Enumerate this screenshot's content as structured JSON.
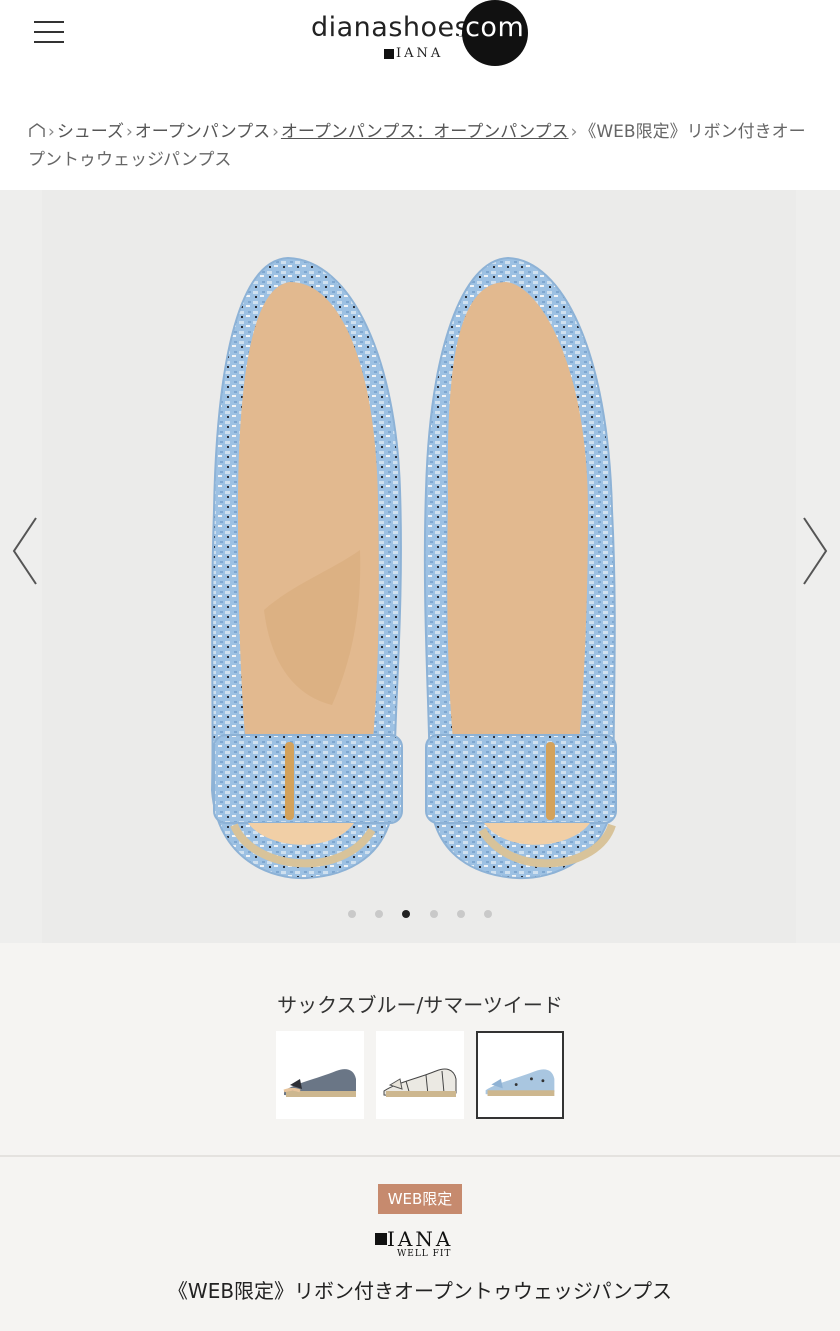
{
  "header": {
    "logo_text": "dianashoes",
    "logo_com": ".com",
    "logo_sub": "IANA",
    "menu_icon": "hamburger-menu-icon"
  },
  "breadcrumb": {
    "home_icon": "home-icon",
    "separator": "›",
    "items": [
      {
        "label": "シューズ"
      },
      {
        "label": "オープンパンプス"
      },
      {
        "label": "オープンパンプス：オープンパンプス"
      },
      {
        "label": "《WEB限定》リボン付きオープントゥウェッジパンプス"
      }
    ]
  },
  "gallery": {
    "prev_icon": "chevron-left-icon",
    "next_icon": "chevron-right-icon",
    "slide_count": 6,
    "active_slide": 3,
    "colors": {
      "background": "#ebebea",
      "tweed": "#9dc1e3",
      "insole": "#e2b98f",
      "trim": "#d8c39a",
      "hardware": "#d3a25c"
    }
  },
  "colors": {
    "selected_name": "サックスブルー/サマーツイード",
    "swatches": [
      {
        "name": "navy-denim",
        "upper": "#6a7686",
        "selected": false
      },
      {
        "name": "white-check",
        "upper": "#ebe9e3",
        "selected": false
      },
      {
        "name": "sax-blue-tweed",
        "upper": "#a9c6e0",
        "selected": true
      }
    ]
  },
  "product": {
    "badge": "WEB限定",
    "brand": "IANA",
    "brand_sub": "WELL FIT",
    "title": "《WEB限定》リボン付きオープントゥウェッジパンプス"
  },
  "theme": {
    "badge_color": "#c68a6e",
    "section_bg": "#f5f4f2"
  }
}
